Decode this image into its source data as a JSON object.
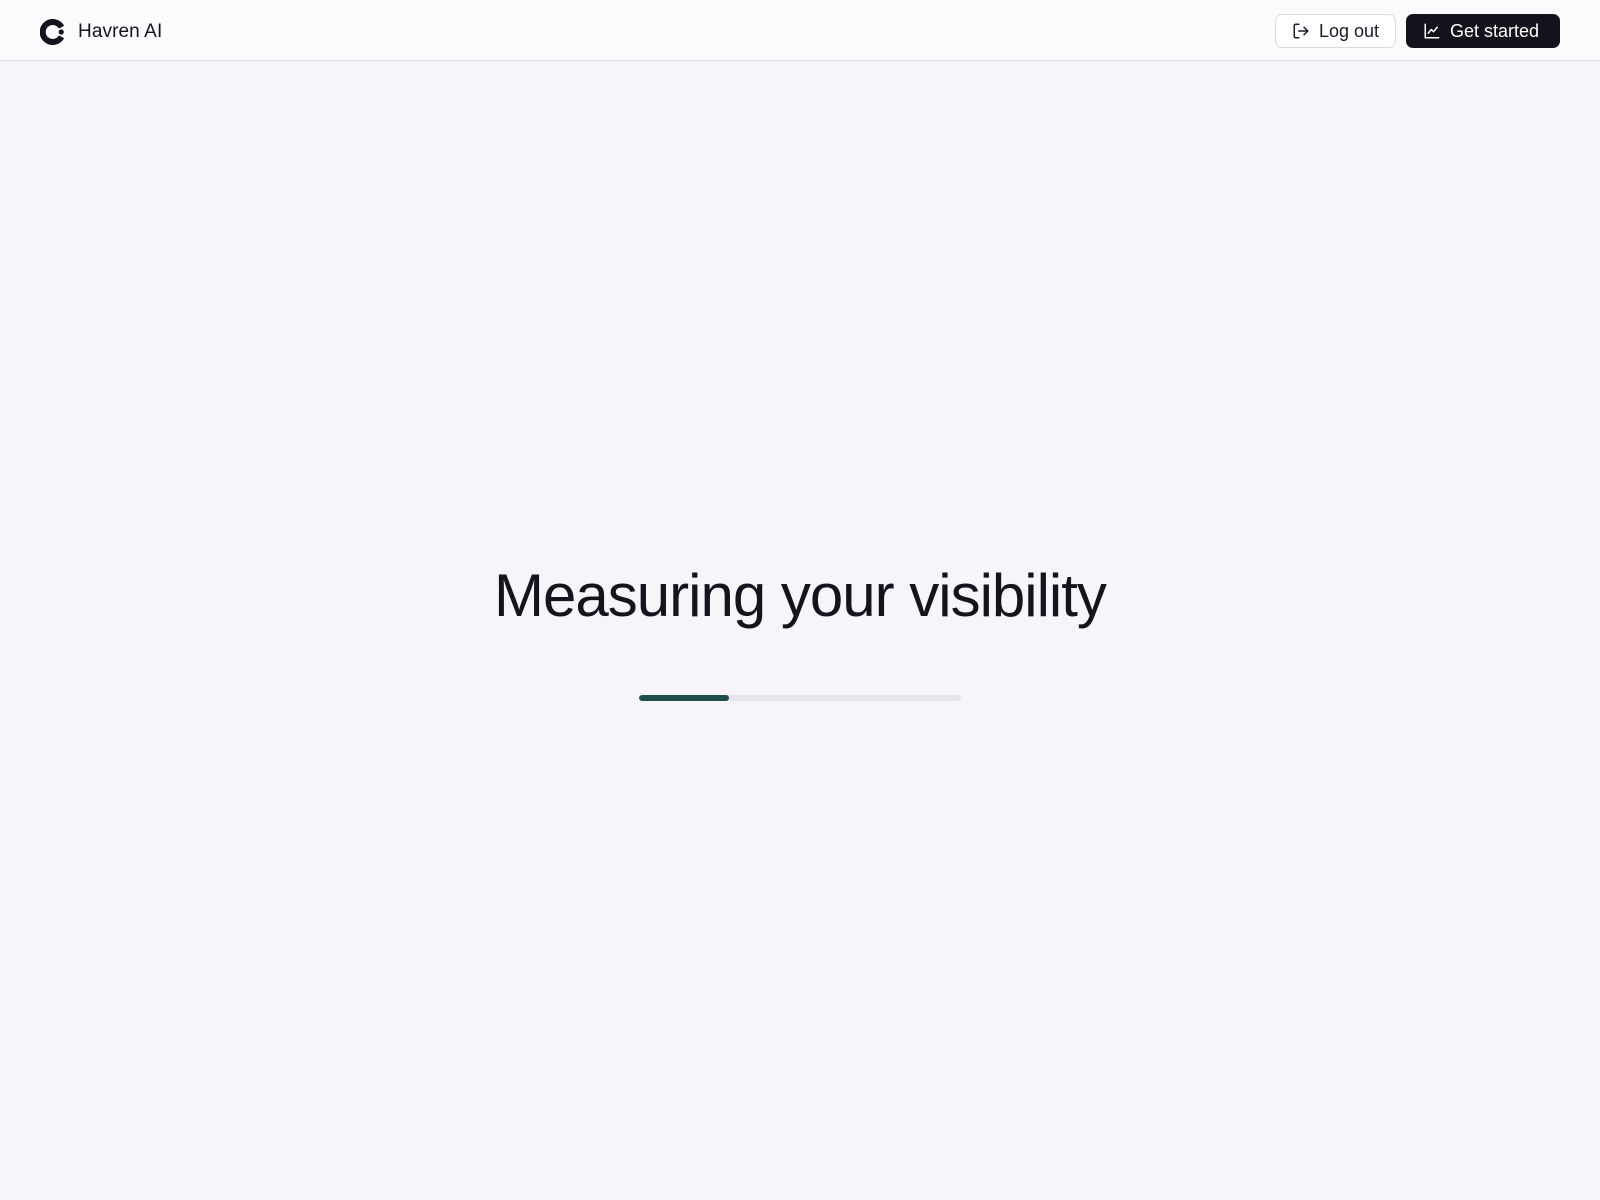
{
  "app": {
    "name": "Havren AI",
    "logo_icon": "brand-logo-icon"
  },
  "header": {
    "logout_label": "Log out",
    "logout_icon": "log-out-icon",
    "get_started_label": "Get started",
    "get_started_icon": "line-chart-icon"
  },
  "main": {
    "headline": "Measuring your visibility",
    "progress": 0.28
  },
  "colors": {
    "background": "#f7f5fa",
    "header_background": "#fbfafd",
    "primary_button": "#14121c",
    "progress_fill": "#1e4d4a",
    "progress_track": "#e6e3ec",
    "text": "#16131f"
  }
}
